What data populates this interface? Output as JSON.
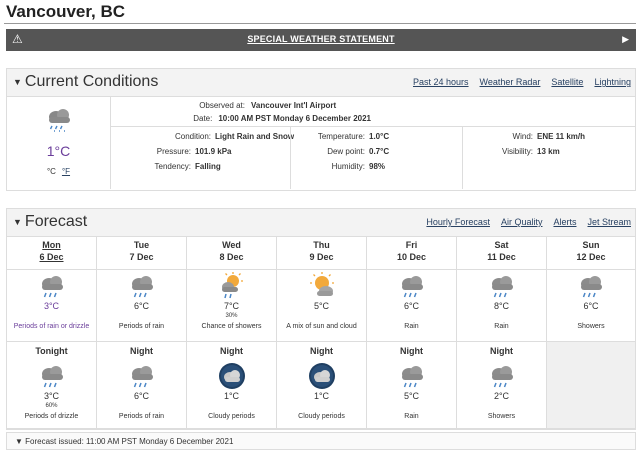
{
  "page": {
    "title": "Vancouver, BC"
  },
  "alert": {
    "text": "SPECIAL WEATHER STATEMENT",
    "warn_glyph": "⚠",
    "arrow_glyph": "▶"
  },
  "current": {
    "title": "Current Conditions",
    "links": [
      "Past 24 hours",
      "Weather Radar",
      "Satellite",
      "Lightning"
    ],
    "icon": "rain-snow-icon",
    "temp": "1°C",
    "unit_c": "°C",
    "unit_f": "°F",
    "observed_label": "Observed at:",
    "observed_value": "Vancouver Int'l Airport",
    "date_label": "Date:",
    "date_value": "10:00 AM PST Monday 6 December 2021",
    "condition_label": "Condition:",
    "condition_value": "Light Rain and Snow",
    "pressure_label": "Pressure:",
    "pressure_value": "101.9 kPa",
    "tendency_label": "Tendency:",
    "tendency_value": "Falling",
    "temperature_label": "Temperature:",
    "temperature_value": "1.0°C",
    "dewpoint_label": "Dew point:",
    "dewpoint_value": "0.7°C",
    "humidity_label": "Humidity:",
    "humidity_value": "98%",
    "wind_label": "Wind:",
    "wind_value": "ENE 11 km/h",
    "visibility_label": "Visibility:",
    "visibility_value": "13 km"
  },
  "forecast": {
    "title": "Forecast",
    "links": [
      "Hourly Forecast",
      "Air Quality",
      "Alerts",
      "Jet Stream"
    ],
    "days": [
      {
        "name": "Mon",
        "date": "6 Dec",
        "icon": "rain-icon",
        "temp": "3°C",
        "pop": "",
        "summary": "Periods of rain or drizzle"
      },
      {
        "name": "Tue",
        "date": "7 Dec",
        "icon": "rain-icon",
        "temp": "6°C",
        "pop": "",
        "summary": "Periods of rain"
      },
      {
        "name": "Wed",
        "date": "8 Dec",
        "icon": "sun-showers-icon",
        "temp": "7°C",
        "pop": "30%",
        "summary": "Chance of showers"
      },
      {
        "name": "Thu",
        "date": "9 Dec",
        "icon": "sun-cloud-icon",
        "temp": "5°C",
        "pop": "",
        "summary": "A mix of sun and cloud"
      },
      {
        "name": "Fri",
        "date": "10 Dec",
        "icon": "rain-icon",
        "temp": "6°C",
        "pop": "",
        "summary": "Rain"
      },
      {
        "name": "Sat",
        "date": "11 Dec",
        "icon": "rain-icon",
        "temp": "8°C",
        "pop": "",
        "summary": "Rain"
      },
      {
        "name": "Sun",
        "date": "12 Dec",
        "icon": "rain-icon",
        "temp": "6°C",
        "pop": "",
        "summary": "Showers"
      }
    ],
    "nights": [
      {
        "name": "Tonight",
        "icon": "rain-icon",
        "temp": "3°C",
        "pop": "60%",
        "summary": "Periods of drizzle"
      },
      {
        "name": "Night",
        "icon": "rain-icon",
        "temp": "6°C",
        "pop": "",
        "summary": "Periods of rain"
      },
      {
        "name": "Night",
        "icon": "cloudy-night-icon",
        "temp": "1°C",
        "pop": "",
        "summary": "Cloudy periods"
      },
      {
        "name": "Night",
        "icon": "cloudy-night-icon",
        "temp": "1°C",
        "pop": "",
        "summary": "Cloudy periods"
      },
      {
        "name": "Night",
        "icon": "rain-icon",
        "temp": "5°C",
        "pop": "",
        "summary": "Rain"
      },
      {
        "name": "Night",
        "icon": "rain-icon",
        "temp": "2°C",
        "pop": "",
        "summary": "Showers"
      }
    ],
    "issued": "Forecast issued: 11:00 AM PST Monday 6 December 2021"
  },
  "colors": {
    "alert_bg": "#555555",
    "link": "#284162",
    "current_temp": "#6a3d9a"
  }
}
